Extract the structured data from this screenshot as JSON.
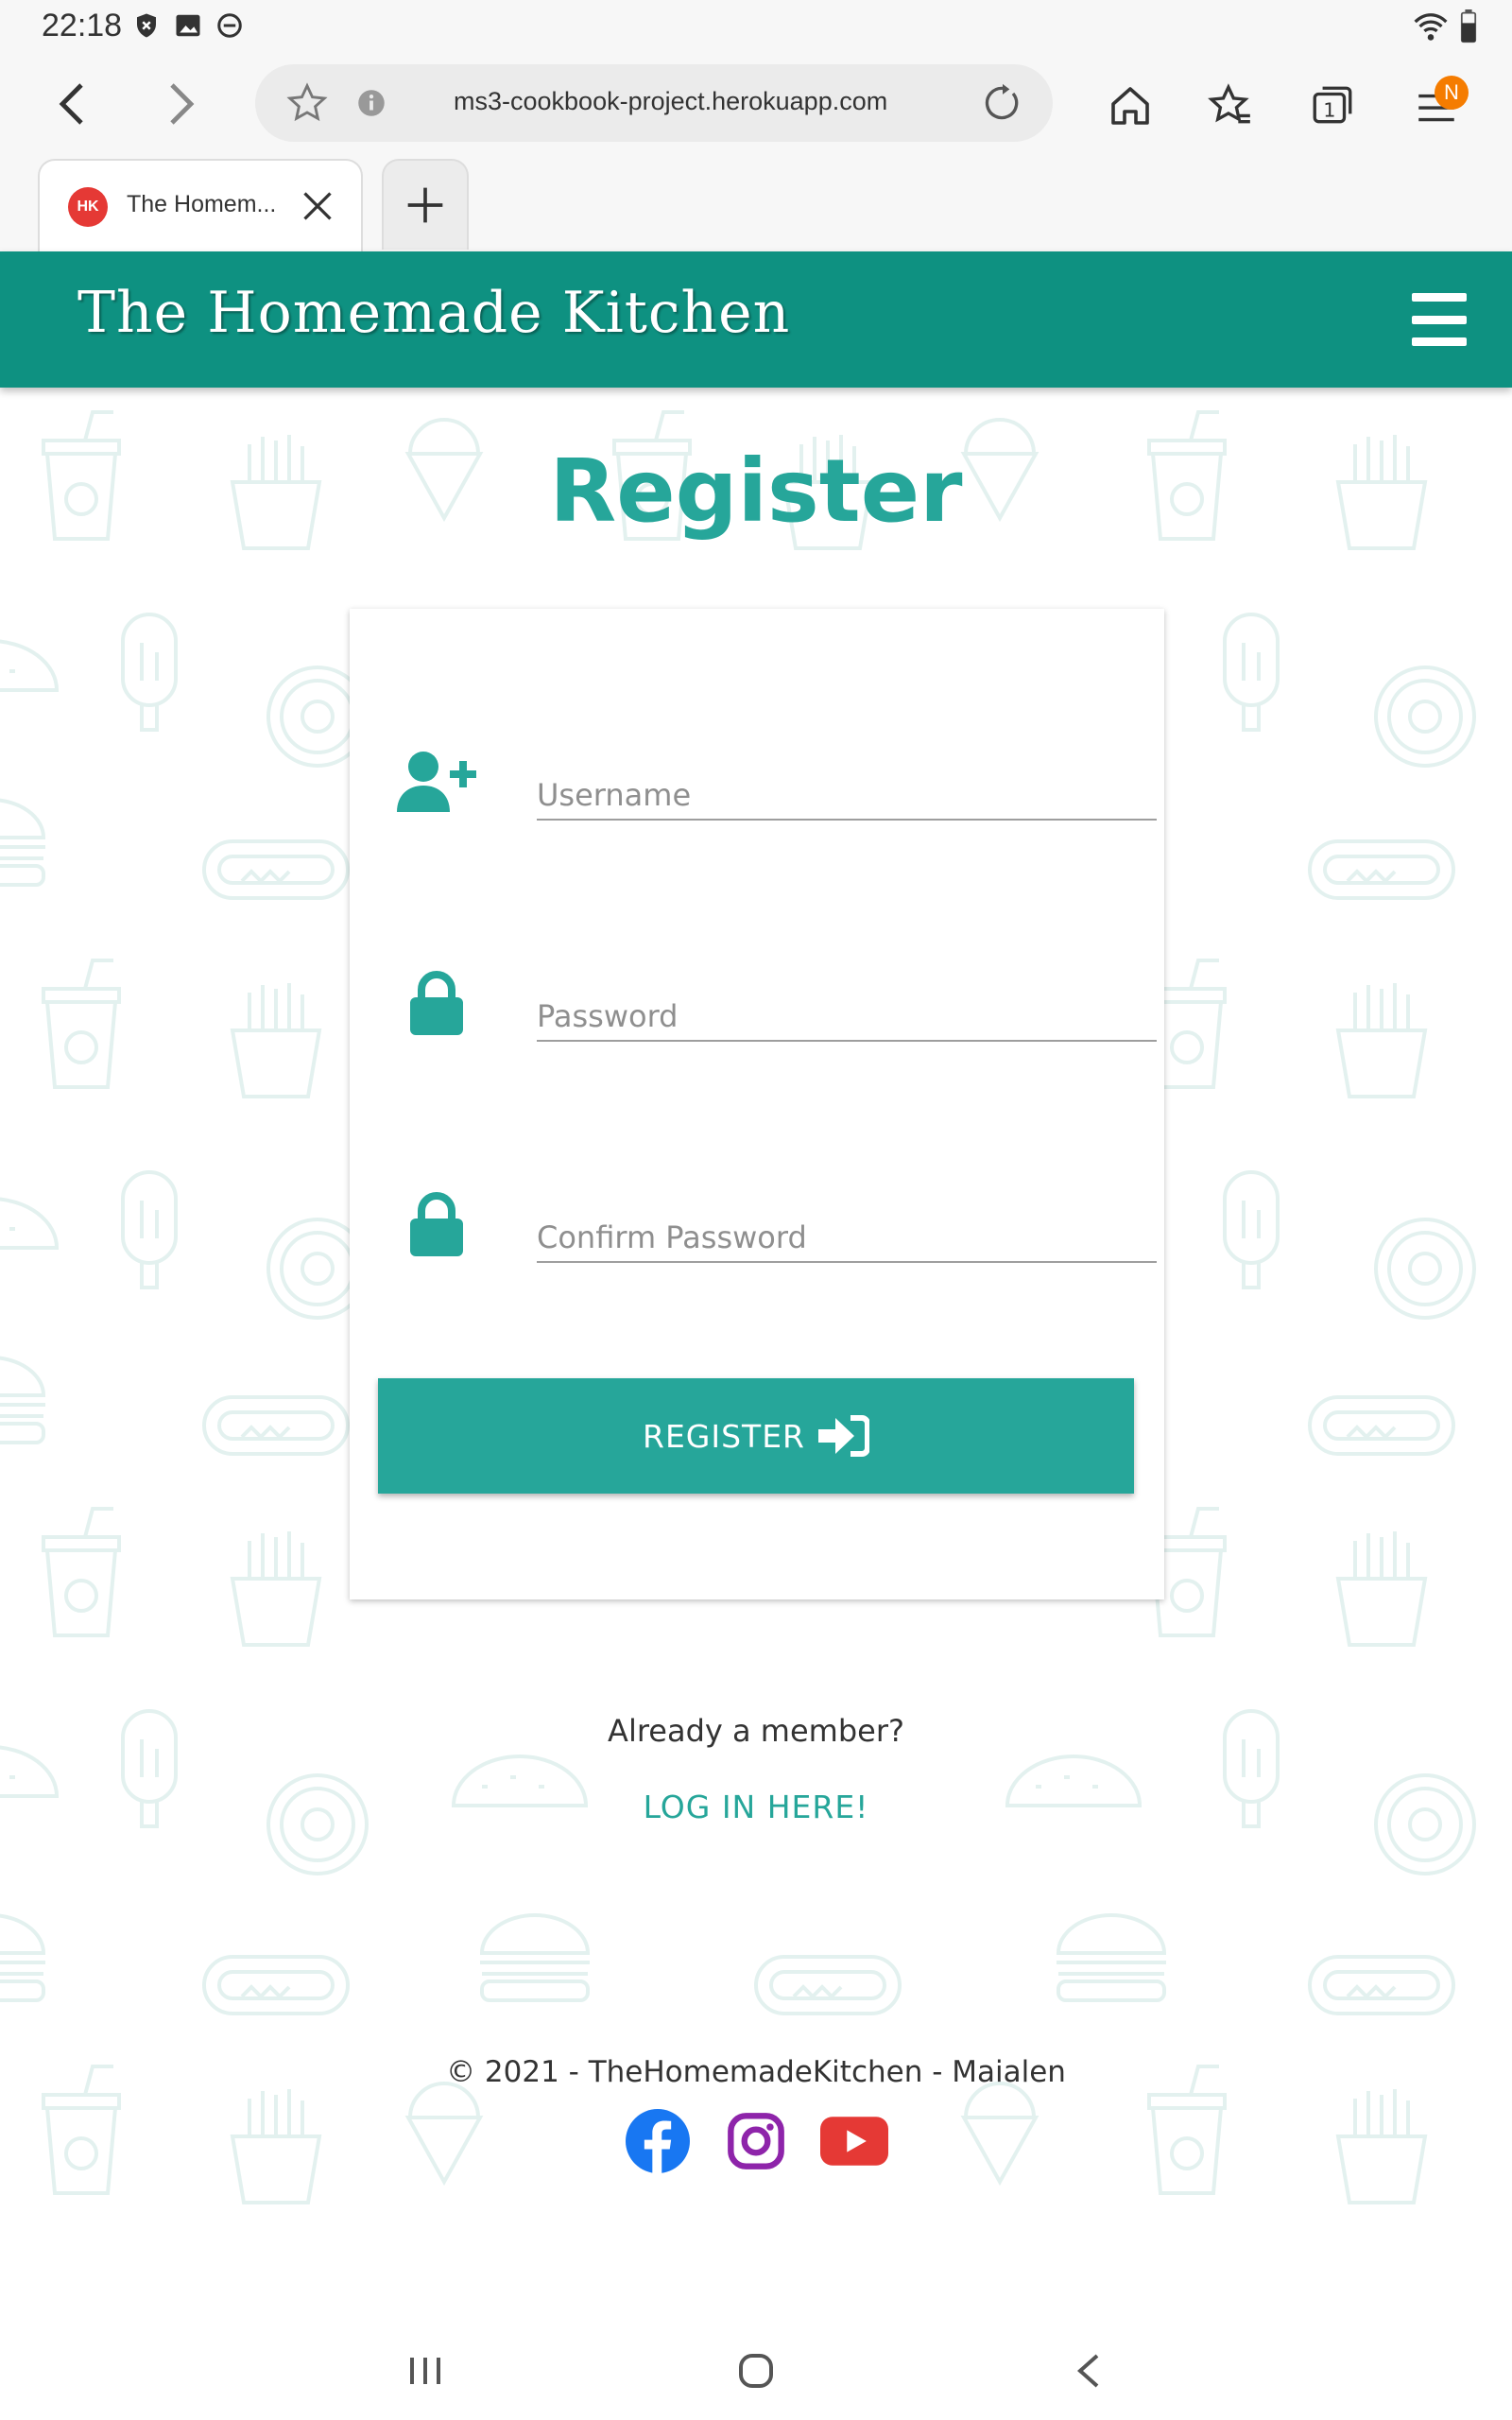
{
  "status_bar": {
    "time": "22:18"
  },
  "browser": {
    "url": "ms3-cookbook-project.herokuapp.com",
    "tab_title": "The Homem...",
    "tab_favicon_text": "HK",
    "tab_count": "1",
    "menu_badge": "N"
  },
  "site": {
    "brand": "The Homemade Kitchen",
    "accent_color": "#26a69a",
    "header_color": "#0e9181"
  },
  "page": {
    "title": "Register"
  },
  "form": {
    "username_placeholder": "Username",
    "password_placeholder": "Password",
    "confirm_placeholder": "Confirm Password",
    "submit_label": "REGISTER"
  },
  "login_prompt": {
    "question": "Already a member?",
    "link_label": "LOG IN HERE!"
  },
  "footer": {
    "copyright": "© 2021 - TheHomemadeKitchen - Maialen",
    "socials": [
      "facebook-icon",
      "instagram-icon",
      "youtube-icon"
    ]
  }
}
